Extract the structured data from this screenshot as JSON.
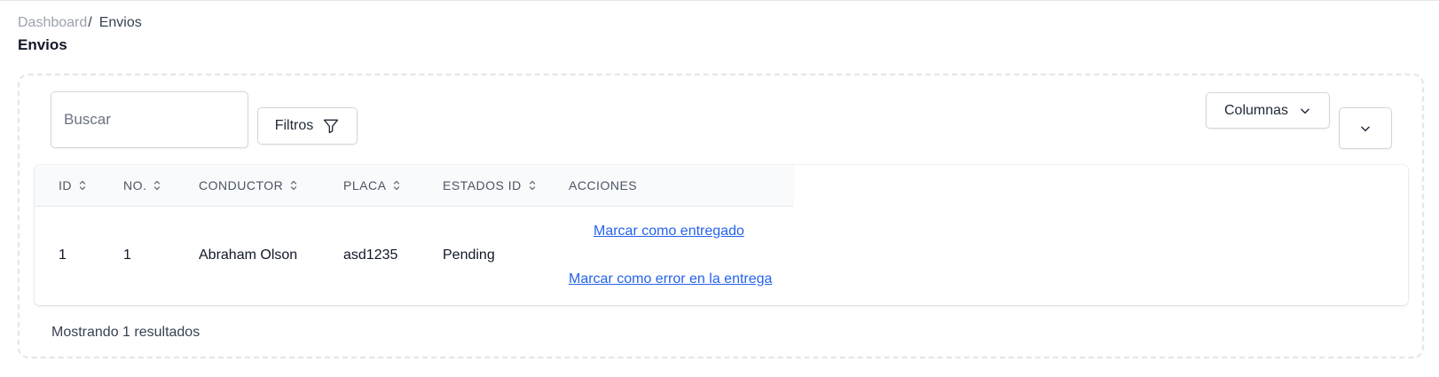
{
  "breadcrumb": {
    "root": "Dashboard",
    "separator": "/",
    "current": "Envios"
  },
  "page": {
    "title": "Envios"
  },
  "toolbar": {
    "search_placeholder": "Buscar",
    "search_value": "",
    "filters_label": "Filtros",
    "filters_icon": "funnel-icon",
    "columns_label": "Columnas",
    "columns_icon": "chevron-down-icon",
    "dropdown_icon": "chevron-down-icon"
  },
  "table": {
    "columns": [
      {
        "label": "ID",
        "sortable": true
      },
      {
        "label": "No.",
        "sortable": true
      },
      {
        "label": "Conductor",
        "sortable": true
      },
      {
        "label": "Placa",
        "sortable": true
      },
      {
        "label": "Estados ID",
        "sortable": true
      },
      {
        "label": "Acciones",
        "sortable": false
      }
    ],
    "rows": [
      {
        "id": "1",
        "no": "1",
        "conductor": "Abraham Olson",
        "placa": "asd1235",
        "estado": "Pending",
        "actions": [
          "Marcar como entregado",
          "Marcar como error en la entrega"
        ]
      }
    ]
  },
  "footer": {
    "results_text": "Mostrando 1 resultados"
  },
  "colors": {
    "link": "#2563eb",
    "muted_text": "#9ca3af",
    "header_bg": "#f9fafb",
    "border": "#d1d5db"
  }
}
